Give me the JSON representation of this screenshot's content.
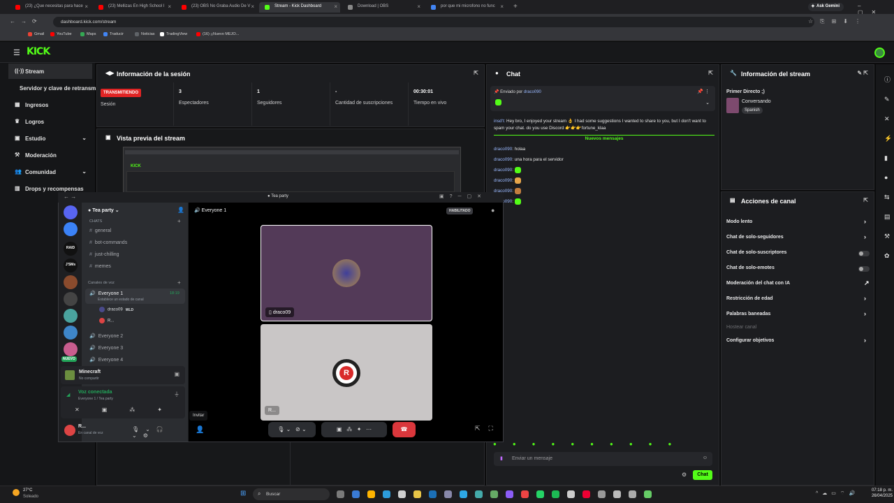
{
  "browser": {
    "tabs": [
      {
        "label": "(23) ¿Que necesitas para hace",
        "color": "#ff0000"
      },
      {
        "label": "(23) Mellizas En High School l",
        "color": "#ff0000"
      },
      {
        "label": "(23) OBS No Graba Audio De V",
        "color": "#ff0000"
      },
      {
        "label": "Stream - Kick Dashboard",
        "color": "#53fc18"
      },
      {
        "label": "Download | OBS",
        "color": "#888888"
      },
      {
        "label": "por que mi microfono no func",
        "color": "#4285f4"
      }
    ],
    "new_tab": "+",
    "ask_gemini": "Ask Gemini",
    "url": "dashboard.kick.com/stream",
    "bookmarks": [
      {
        "label": "Gmail",
        "color": "#ea4335"
      },
      {
        "label": "YouTube",
        "color": "#ff0000"
      },
      {
        "label": "Maps",
        "color": "#34a853"
      },
      {
        "label": "Traducir",
        "color": "#4285f4"
      },
      {
        "label": "Noticias",
        "color": "#5f6368"
      },
      {
        "label": "TradingView",
        "color": "#ffffff"
      },
      {
        "label": "(16) ¡¡Nuevo MEJO...",
        "color": "#ff0000"
      }
    ]
  },
  "kick": {
    "logo": "KICK",
    "sidebar": [
      {
        "label": "Stream",
        "icon": "((·))",
        "active": true
      },
      {
        "label": "Servidor y clave de retransm",
        "icon": ""
      },
      {
        "label": "Ingresos",
        "icon": "▦"
      },
      {
        "label": "Logros",
        "icon": "♛"
      },
      {
        "label": "Estudio",
        "icon": "▣",
        "chevron": "⌄"
      },
      {
        "label": "Moderación",
        "icon": "⚒"
      },
      {
        "label": "Comunidad",
        "icon": "👥",
        "chevron": "⌄"
      },
      {
        "label": "Drops y recompensas",
        "icon": "▥"
      }
    ],
    "session": {
      "title": "Información de la sesión",
      "badge": "TRANSMITIENDO",
      "badge_label": "Sesión",
      "stats": [
        {
          "value": "3",
          "label": "Espectadores"
        },
        {
          "value": "1",
          "label": "Seguidores"
        },
        {
          "value": "-",
          "label": "Cantidad de suscripciones"
        },
        {
          "value": "00:30:01",
          "label": "Tiempo en vivo"
        }
      ]
    },
    "preview": {
      "title": "Vista previa del stream"
    },
    "chat": {
      "title": "Chat",
      "pinned_by": "Enviado por",
      "pinned_user": "draco090",
      "message_prefix": "insd't:",
      "long_message": "Hey bro, I enjoyed your stream 👌 I had some suggestions I wanted to share to you, but I don't want to spam your chat. do you use Discord 👉👉👉fortune_klaa",
      "new_messages": "Nuevos mensajes",
      "lines": [
        {
          "user": "draco090",
          "text": "holaa"
        },
        {
          "user": "draco090",
          "text": "una hora para el servidor"
        },
        {
          "user": "draco090",
          "text": ""
        },
        {
          "user": "draco090",
          "text": ""
        },
        {
          "user": "draco090",
          "text": ""
        },
        {
          "user": "draco090",
          "text": ""
        }
      ],
      "input_placeholder": "Enviar un mensaje",
      "send_label": "Chat"
    },
    "stream_info": {
      "title": "Información del stream",
      "stream_title": "Primer Directo ;)",
      "category": "Conversando",
      "language": "Spanish"
    },
    "channel_actions": {
      "title": "Acciones de canal",
      "items": [
        {
          "label": "Modo lento",
          "control": "›"
        },
        {
          "label": "Chat de solo-seguidores",
          "control": "›"
        },
        {
          "label": "Chat de solo-suscriptores",
          "control": "toggle"
        },
        {
          "label": "Chat de solo-emotes",
          "control": "toggle"
        },
        {
          "label": "Moderación del chat con IA",
          "control": "↗"
        },
        {
          "label": "Restricción de edad",
          "control": "›"
        },
        {
          "label": "Palabras baneadas",
          "control": "›"
        },
        {
          "label": "Hostear canal",
          "control": "",
          "disabled": true
        },
        {
          "label": "Configurar objetivos",
          "control": "›"
        }
      ]
    }
  },
  "discord": {
    "window_title": "Tea party",
    "server_name": "Tea party",
    "chats_header": "CHATS",
    "text_channels": [
      "general",
      "bot-commands",
      "just-chilling",
      "memes"
    ],
    "voice_header": "Canales de voz",
    "voice_channels": [
      {
        "label": "Everyone 1",
        "time": "18:19",
        "active": true
      },
      {
        "label": "Everyone 2"
      },
      {
        "label": "Everyone 3"
      },
      {
        "label": "Everyone 4"
      }
    ],
    "status_hint": "Establece un estado de canal",
    "members": [
      {
        "label": "draco09",
        "tag": "WLD"
      },
      {
        "label": "R..."
      }
    ],
    "activity": {
      "title": "Minecraft",
      "subtitle": "No compartir"
    },
    "voice_connected": {
      "title": "Voz conectada",
      "subtitle": "Everyone 1 / Tea party"
    },
    "user": {
      "name": "R...",
      "status": "En canal de voz"
    },
    "stage_title": "Everyone 1",
    "stage_badge": "HABILITADO",
    "tile1_name": "draco09",
    "tile2_name": "R...",
    "tooltip": "Invitar",
    "new_badge": "NUEVO",
    "guild_labels": [
      "RAID",
      "J'SMs"
    ]
  },
  "taskbar": {
    "weather_temp": "27°C",
    "weather_desc": "Soleado",
    "search": "Buscar",
    "time": "07:18 p. m.",
    "date": "26/04/2025"
  }
}
